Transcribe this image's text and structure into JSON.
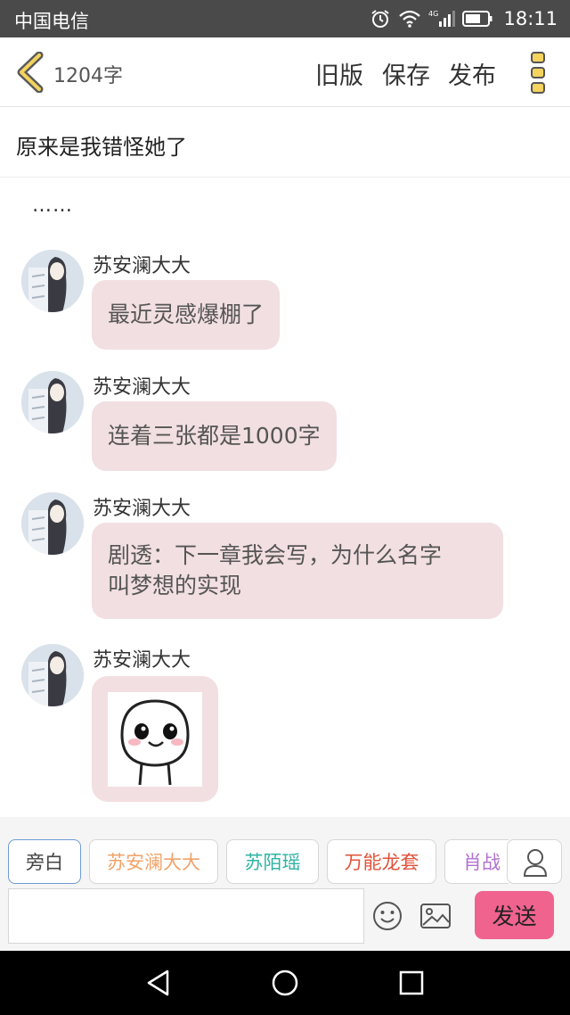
{
  "status_bar": {
    "carrier": "中国电信",
    "time": "18:11",
    "network": "4G"
  },
  "header": {
    "word_count": "1204字",
    "old_version": "旧版",
    "save": "保存",
    "publish": "发布"
  },
  "chapter": {
    "title": "原来是我错怪她了"
  },
  "narration": "……",
  "messages": [
    {
      "name": "苏安澜大大",
      "lines": [
        "最近灵感爆棚了"
      ]
    },
    {
      "name": "苏安澜大大",
      "lines": [
        "连着三张都是1000字"
      ]
    },
    {
      "name": "苏安澜大大",
      "lines": [
        "剧透：下一章我会写，为什么名字",
        "叫梦想的实现"
      ]
    },
    {
      "name": "苏安澜大大",
      "sticker": "smiling-face-sticker"
    }
  ],
  "roles": [
    {
      "label": "旁白",
      "color": "#444444"
    },
    {
      "label": "苏安澜大大",
      "color": "#f0a36a"
    },
    {
      "label": "苏陌瑶",
      "color": "#2fb3a3"
    },
    {
      "label": "万能龙套",
      "color": "#e0523a"
    },
    {
      "label": "肖战",
      "color": "#b070d0"
    }
  ],
  "composer": {
    "input_value": "",
    "send_label": "发送"
  },
  "colors": {
    "bubble": "#f2dfe1",
    "send": "#f0638f",
    "accent": "#6f9bd3"
  }
}
